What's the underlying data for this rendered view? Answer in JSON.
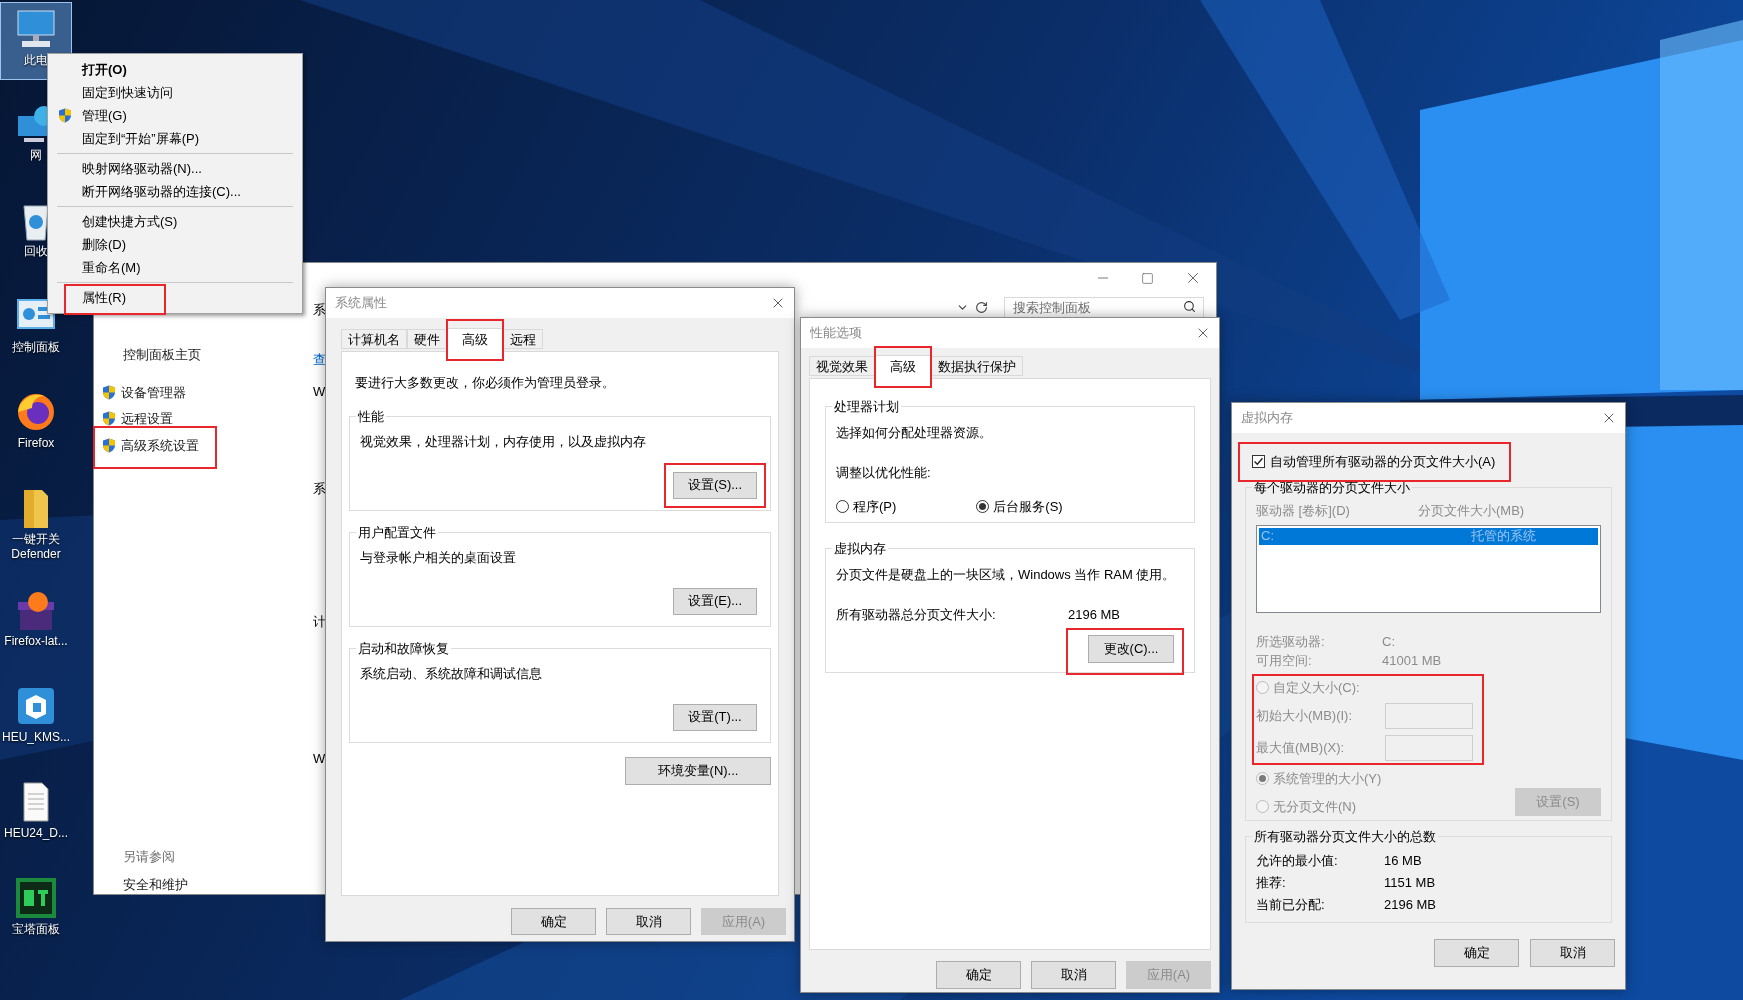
{
  "desktop": {
    "icons": [
      {
        "label": "此电",
        "kind": "pc",
        "selected": true
      },
      {
        "label": "网",
        "kind": "network",
        "selected": false
      },
      {
        "label": "回收",
        "kind": "recycle",
        "selected": false
      },
      {
        "label": "控制面板",
        "kind": "control-panel",
        "selected": false
      },
      {
        "label": "Firefox",
        "kind": "firefox",
        "selected": false
      },
      {
        "label": "一键开关 Defender",
        "kind": "folder",
        "selected": false
      },
      {
        "label": "Firefox-lat...",
        "kind": "gift",
        "selected": false
      },
      {
        "label": "HEU_KMS...",
        "kind": "cube",
        "selected": false
      },
      {
        "label": "HEU24_D...",
        "kind": "document",
        "selected": false
      },
      {
        "label": "宝塔面板",
        "kind": "bt",
        "selected": false
      }
    ]
  },
  "context_menu": {
    "groups": [
      [
        {
          "label": "打开(O)",
          "kind": "default",
          "highlighted": false
        },
        {
          "label": "固定到快速访问",
          "kind": "plain",
          "highlighted": false
        },
        {
          "label": "管理(G)",
          "kind": "shield",
          "highlighted": false
        },
        {
          "label": "固定到“开始”屏幕(P)",
          "kind": "plain",
          "highlighted": false
        }
      ],
      [
        {
          "label": "映射网络驱动器(N)...",
          "kind": "plain",
          "highlighted": false
        },
        {
          "label": "断开网络驱动器的连接(C)...",
          "kind": "plain",
          "highlighted": false
        }
      ],
      [
        {
          "label": "创建快捷方式(S)",
          "kind": "plain",
          "highlighted": false
        },
        {
          "label": "删除(D)",
          "kind": "plain",
          "highlighted": false
        },
        {
          "label": "重命名(M)",
          "kind": "plain",
          "highlighted": false
        }
      ],
      [
        {
          "label": "属性(R)",
          "kind": "plain",
          "highlighted": true
        }
      ]
    ]
  },
  "control_panel": {
    "search": {
      "placeholder": "搜索控制面板"
    },
    "sidebar": {
      "home": "控制面板主页",
      "items": [
        {
          "label": "设备管理器",
          "highlighted": false
        },
        {
          "label": "远程设置",
          "highlighted": false
        },
        {
          "label": "高级系统设置",
          "highlighted": true
        }
      ],
      "see_also": {
        "heading": "另请参阅",
        "links": [
          "安全和维护"
        ]
      }
    },
    "fragments": [
      {
        "text": "系",
        "kind": "text"
      },
      {
        "text": "查",
        "kind": "link"
      },
      {
        "text": "W",
        "kind": "text"
      },
      {
        "text": "系",
        "kind": "text"
      },
      {
        "text": "计",
        "kind": "text"
      },
      {
        "text": "W",
        "kind": "text"
      }
    ]
  },
  "system_properties": {
    "title": "系统属性",
    "tabs": [
      {
        "label": "计算机名",
        "selected": false,
        "highlighted": false
      },
      {
        "label": "硬件",
        "selected": false,
        "highlighted": false
      },
      {
        "label": "高级",
        "selected": true,
        "highlighted": true
      },
      {
        "label": "远程",
        "selected": false,
        "highlighted": false
      }
    ],
    "notice": "要进行大多数更改，你必须作为管理员登录。",
    "groups": [
      {
        "title": "性能",
        "description": "视觉效果，处理器计划，内存使用，以及虚拟内存",
        "button": {
          "label": "设置(S)...",
          "highlighted": true
        }
      },
      {
        "title": "用户配置文件",
        "description": "与登录帐户相关的桌面设置",
        "button": {
          "label": "设置(E)...",
          "highlighted": false
        }
      },
      {
        "title": "启动和故障恢复",
        "description": "系统启动、系统故障和调试信息",
        "button": {
          "label": "设置(T)...",
          "highlighted": false
        }
      }
    ],
    "env_button": "环境变量(N)...",
    "buttons": [
      {
        "label": "确定",
        "disabled": false
      },
      {
        "label": "取消",
        "disabled": false
      },
      {
        "label": "应用(A)",
        "disabled": true
      }
    ]
  },
  "performance_options": {
    "title": "性能选项",
    "tabs": [
      {
        "label": "视觉效果",
        "selected": false,
        "highlighted": false
      },
      {
        "label": "高级",
        "selected": true,
        "highlighted": true
      },
      {
        "label": "数据执行保护",
        "selected": false,
        "highlighted": false
      }
    ],
    "processor": {
      "title": "处理器计划",
      "description": "选择如何分配处理器资源。",
      "adjust_label": "调整以优化性能:",
      "options": [
        {
          "label": "程序(P)",
          "selected": false
        },
        {
          "label": "后台服务(S)",
          "selected": true
        }
      ]
    },
    "virtual_memory": {
      "title": "虚拟内存",
      "description": "分页文件是硬盘上的一块区域，Windows 当作 RAM 使用。",
      "total_label": "所有驱动器总分页文件大小:",
      "total_value": "2196 MB",
      "button": {
        "label": "更改(C)...",
        "highlighted": true
      }
    },
    "buttons": [
      {
        "label": "确定",
        "disabled": false
      },
      {
        "label": "取消",
        "disabled": false
      },
      {
        "label": "应用(A)",
        "disabled": true
      }
    ]
  },
  "virtual_memory": {
    "title": "虚拟内存",
    "auto_manage": {
      "label": "自动管理所有驱动器的分页文件大小(A)",
      "checked": true,
      "highlighted": true
    },
    "per_drive": {
      "title": "每个驱动器的分页文件大小",
      "disabled": true,
      "columns": [
        "驱动器 [卷标](D)",
        "分页文件大小(MB)"
      ],
      "rows": [
        {
          "cells": [
            "C:",
            "托管的系统"
          ],
          "selected": true
        }
      ],
      "selected_drive_label": "所选驱动器:",
      "selected_drive": "C:",
      "free_space_label": "可用空间:",
      "free_space": "41001 MB",
      "custom_size": {
        "label": "自定义大小(C):",
        "selected": false,
        "highlighted": true,
        "fields": [
          {
            "label": "初始大小(MB)(I):"
          },
          {
            "label": "最大值(MB)(X):"
          }
        ]
      },
      "other_options": [
        {
          "label": "系统管理的大小(Y)",
          "selected": true
        },
        {
          "label": "无分页文件(N)",
          "selected": false
        }
      ],
      "set_button": {
        "label": "设置(S)",
        "disabled": true
      }
    },
    "totals": {
      "title": "所有驱动器分页文件大小的总数",
      "rows": [
        {
          "label": "允许的最小值:",
          "value": "16 MB"
        },
        {
          "label": "推荐:",
          "value": "1151 MB"
        },
        {
          "label": "当前已分配:",
          "value": "2196 MB"
        }
      ]
    },
    "buttons": [
      {
        "label": "确定",
        "disabled": false
      },
      {
        "label": "取消",
        "disabled": false
      }
    ]
  }
}
